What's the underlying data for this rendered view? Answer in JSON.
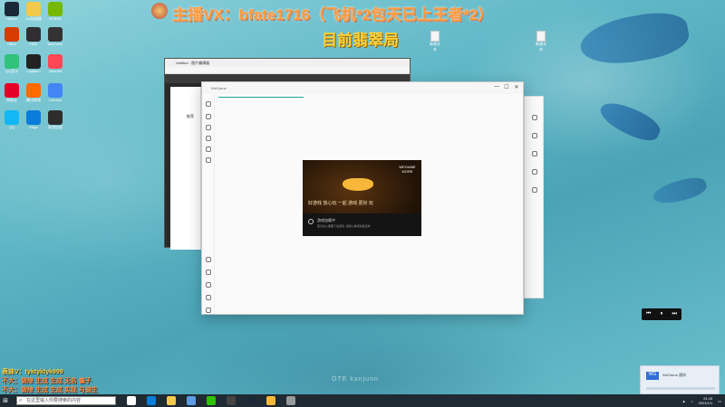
{
  "overlay": {
    "title": "主播VX：bfate1716（飞机*2包天已上王者*2）",
    "rank": "目前翡翠局"
  },
  "bottom_notes": [
    "表妹V：tyktyktyk999",
    "不大：做除 生成 生成 无名 偏子",
    "不大：做除 生成 生成 实现 与调生"
  ],
  "desktop": {
    "icons": [
      {
        "label": "Steam",
        "color": "#1b2838"
      },
      {
        "label": "UU加速器",
        "color": "#f2c94c"
      },
      {
        "label": "NVIDIA",
        "color": "#76b900"
      },
      {
        "label": "Office",
        "color": "#d83b01"
      },
      {
        "label": "OBS",
        "color": "#302e31"
      },
      {
        "label": "WeGame",
        "color": "#333"
      },
      {
        "label": "QQ音乐",
        "color": "#31c27c"
      },
      {
        "label": "Logitech",
        "color": "#222"
      },
      {
        "label": "Valorant",
        "color": "#ff4655"
      },
      {
        "label": "网易云",
        "color": "#e60026"
      },
      {
        "label": "腾讯视频",
        "color": "#ff6a00"
      },
      {
        "label": "Chrome",
        "color": "#4285f4"
      },
      {
        "label": "QQ",
        "color": "#12b7f5"
      },
      {
        "label": "Edge",
        "color": "#0a7cdb"
      },
      {
        "label": "网游加速",
        "color": "#2d2d2d"
      }
    ],
    "top_files": [
      "新建文本",
      "新建文本"
    ]
  },
  "back_window": {
    "title": "Untitled - 图片编辑器"
  },
  "behind_panel": {
    "heading": "推荐"
  },
  "main_window": {
    "title": "WeGame",
    "controls": {
      "minimize": "—",
      "maximize": "☐",
      "close": "✕"
    }
  },
  "splash": {
    "brand": "WEGAME MORE",
    "slogan": "好游戏 放心玩  一起 游戏 更好 玩",
    "status": "游戏加载中",
    "sub": "首次进入需要下载游戏, 请耐心等待加载完成"
  },
  "watermark": "OTE kanjunn",
  "media_widget": {
    "prev": "⏮",
    "play": "⏸",
    "next": "⏭"
  },
  "toast": {
    "logo": "WG",
    "text": "WeGame 通知"
  },
  "taskbar": {
    "search_placeholder": "在这里输入你要搜索的内容",
    "time": "21:15",
    "date": "2021/1/1",
    "icons": [
      {
        "name": "task-view",
        "color": "#ffffff"
      },
      {
        "name": "edge",
        "color": "#0a7cdb"
      },
      {
        "name": "explorer",
        "color": "#f2c94c"
      },
      {
        "name": "store",
        "color": "#5e9de6"
      },
      {
        "name": "wechat",
        "color": "#2dc100"
      },
      {
        "name": "obs",
        "color": "#444"
      },
      {
        "name": "steam",
        "color": "#1b2838"
      },
      {
        "name": "wegame",
        "color": "#f7b739"
      },
      {
        "name": "game",
        "color": "#999"
      }
    ]
  }
}
